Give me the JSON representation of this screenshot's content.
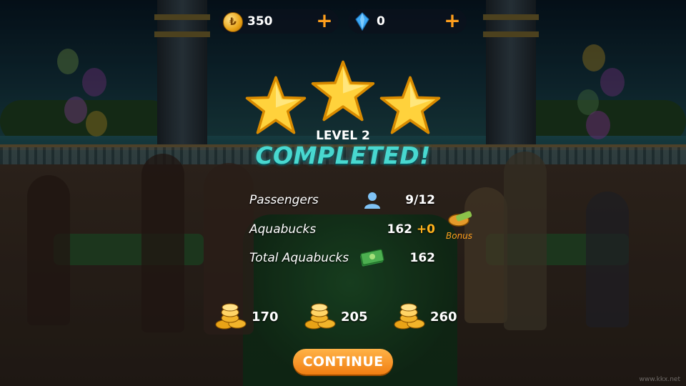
{
  "hud": {
    "coins": "350",
    "gems": "0"
  },
  "result": {
    "stars_earned": 3,
    "stars_total": 3,
    "level_text": "LEVEL 2",
    "status_text": "COMPLETED!"
  },
  "stats": {
    "passengers_label": "Passengers",
    "passengers_value": "9/12",
    "aquabucks_label": "Aquabucks",
    "aquabucks_value": "162",
    "aquabucks_bonus": "+0",
    "bonus_label": "Bonus",
    "total_label": "Total Aquabucks",
    "total_value": "162"
  },
  "thresholds": [
    "170",
    "205",
    "260"
  ],
  "continue_label": "CONTINUE",
  "watermark": "www.kkx.net",
  "colors": {
    "accent_orange": "#f59a1e",
    "completed_teal": "#48d8d0",
    "star_gold": "#ffd23c"
  }
}
